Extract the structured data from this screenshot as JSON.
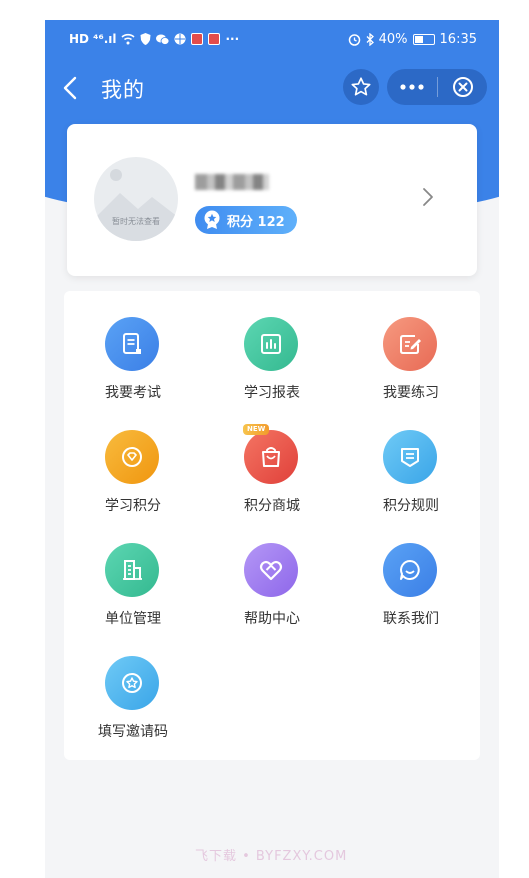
{
  "status_bar": {
    "left_text": "HD ⁴⁶.ıl",
    "more_dots": "···",
    "battery": "40%",
    "battery_level": 0.4,
    "time": "16:35"
  },
  "header": {
    "title": "我的"
  },
  "profile": {
    "avatar_caption": "暂时无法查看",
    "points_label": "积分 122"
  },
  "grid": {
    "items": [
      {
        "label": "我要考试",
        "icon": "exam-icon",
        "color": "#4a8ff0"
      },
      {
        "label": "学习报表",
        "icon": "report-chart-icon",
        "color": "#43c9a5"
      },
      {
        "label": "我要练习",
        "icon": "practice-edit-icon",
        "color": "#f07d66"
      },
      {
        "label": "学习积分",
        "icon": "diamond-icon",
        "color": "#f5a623"
      },
      {
        "label": "积分商城",
        "icon": "shopping-bag-icon",
        "color": "#ee5a52",
        "tag": "NEW"
      },
      {
        "label": "积分规则",
        "icon": "rules-shield-icon",
        "color": "#49b6ee"
      },
      {
        "label": "单位管理",
        "icon": "building-icon",
        "color": "#43c9a5"
      },
      {
        "label": "帮助中心",
        "icon": "help-heart-icon",
        "color": "#a57ef0"
      },
      {
        "label": "联系我们",
        "icon": "chat-bubble-icon",
        "color": "#3f8ff0"
      },
      {
        "label": "填写邀请码",
        "icon": "star-badge-icon",
        "color": "#49b6ee"
      }
    ]
  },
  "watermark": "飞下载 • BYFZXY.COM",
  "colors": {
    "primary": "#3b82e8",
    "capsule": "#2c69c6",
    "background": "#f4f5f7"
  }
}
